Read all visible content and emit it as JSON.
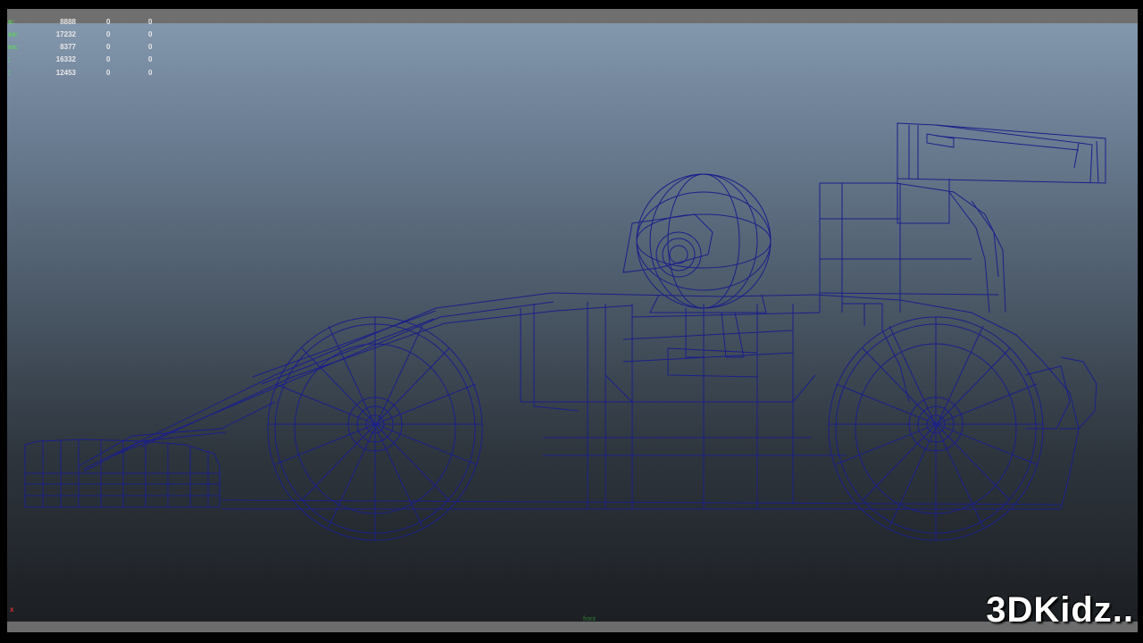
{
  "hud": {
    "rows": [
      {
        "label": "s:",
        "value": "8888",
        "c2": "0",
        "c3": "0"
      },
      {
        "label": "es:",
        "value": "17232",
        "c2": "0",
        "c3": "0"
      },
      {
        "label": "es:",
        "value": "8377",
        "c2": "0",
        "c3": "0"
      },
      {
        "label": ":",
        "value": "16332",
        "c2": "0",
        "c3": "0"
      },
      {
        "label": ":",
        "value": "12453",
        "c2": "0",
        "c3": "0"
      }
    ]
  },
  "viewport": {
    "wire_color": "#1b1f8a",
    "axis_marker": "x",
    "camera_label": "front"
  },
  "watermark": "3DKidz..",
  "colors": {
    "hud_label": "#5fd35f",
    "bg_top": "#8397ad",
    "bg_bottom": "#1c1f23"
  }
}
